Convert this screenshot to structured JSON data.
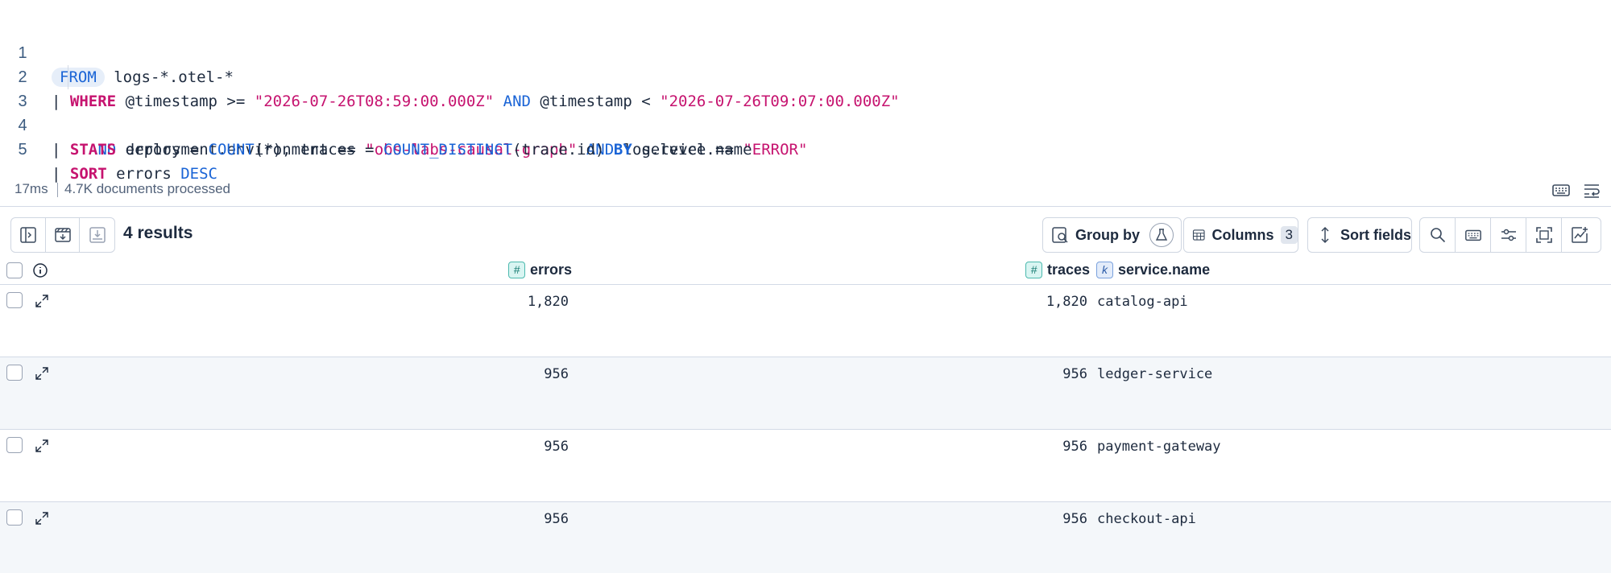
{
  "editor": {
    "lines": [
      {
        "n": "1"
      },
      {
        "n": "2"
      },
      {
        "n": "3"
      },
      {
        "n": "4"
      },
      {
        "n": "5"
      }
    ],
    "tokens": {
      "from": "FROM",
      "index": "logs-*.otel-*",
      "pipe": "|",
      "where": "WHERE",
      "ts_field": "@timestamp",
      "gte": ">=",
      "ts_start": "\"2026-07-26T08:59:00.000Z\"",
      "and": "AND",
      "lt": "<",
      "ts_end": "\"2026-07-26T09:07:00.000Z\"",
      "env_field": "deployment.environment",
      "eq": "==",
      "env_value": "\"obs-labs-causal-graph\"",
      "level_field": "log.level",
      "level_value": "\"ERROR\"",
      "stats": "STATS",
      "errors_assign": "errors =",
      "count_fn": "COUNT",
      "count_arg": "(*),",
      "traces_assign": "traces =",
      "count_distinct_fn": "COUNT_DISTINCT",
      "count_distinct_arg": "(trace.id)",
      "by": "BY",
      "group_field": "service.name",
      "sort": "SORT",
      "sort_field": "errors",
      "desc": "DESC"
    }
  },
  "status": {
    "duration": "17ms",
    "docs": "4.7K documents processed"
  },
  "toolbar": {
    "results": "4 results",
    "group_by": "Group by",
    "columns": "Columns",
    "columns_count": "3",
    "sort_fields": "Sort fields"
  },
  "grid": {
    "columns": {
      "errors": "errors",
      "traces": "traces",
      "service": "service.name",
      "num_type": "#",
      "kw_type": "k"
    },
    "rows": [
      {
        "errors": "1,820",
        "traces": "1,820",
        "service": "catalog-api"
      },
      {
        "errors": "956",
        "traces": "956",
        "service": "ledger-service"
      },
      {
        "errors": "956",
        "traces": "956",
        "service": "payment-gateway"
      },
      {
        "errors": "956",
        "traces": "956",
        "service": "checkout-api"
      }
    ]
  },
  "colors": {
    "keyword": "#c6136f",
    "function": "#1a64d6",
    "string": "#c6136f",
    "row_alt": "#f4f7fa",
    "border": "#d3dae6"
  }
}
